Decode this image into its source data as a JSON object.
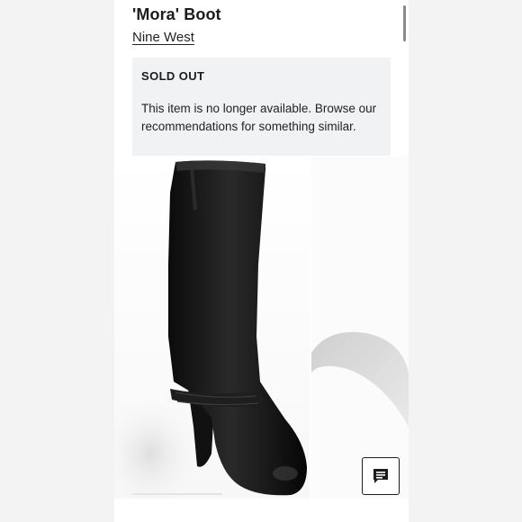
{
  "product": {
    "title": "'Mora' Boot",
    "brand": "Nine West"
  },
  "availability_notice": {
    "status": "SOLD OUT",
    "message": "This item is no longer available. Browse our recommendations for something similar."
  },
  "gallery": {
    "images": [
      {
        "icon": "black-knee-high-boot-photo"
      },
      {
        "icon": "boot-shadow-photo"
      }
    ]
  },
  "chat": {
    "icon": "chat-bubble-icon"
  },
  "colors": {
    "notice_background": "#f1f2f4",
    "boot": "#141414"
  }
}
